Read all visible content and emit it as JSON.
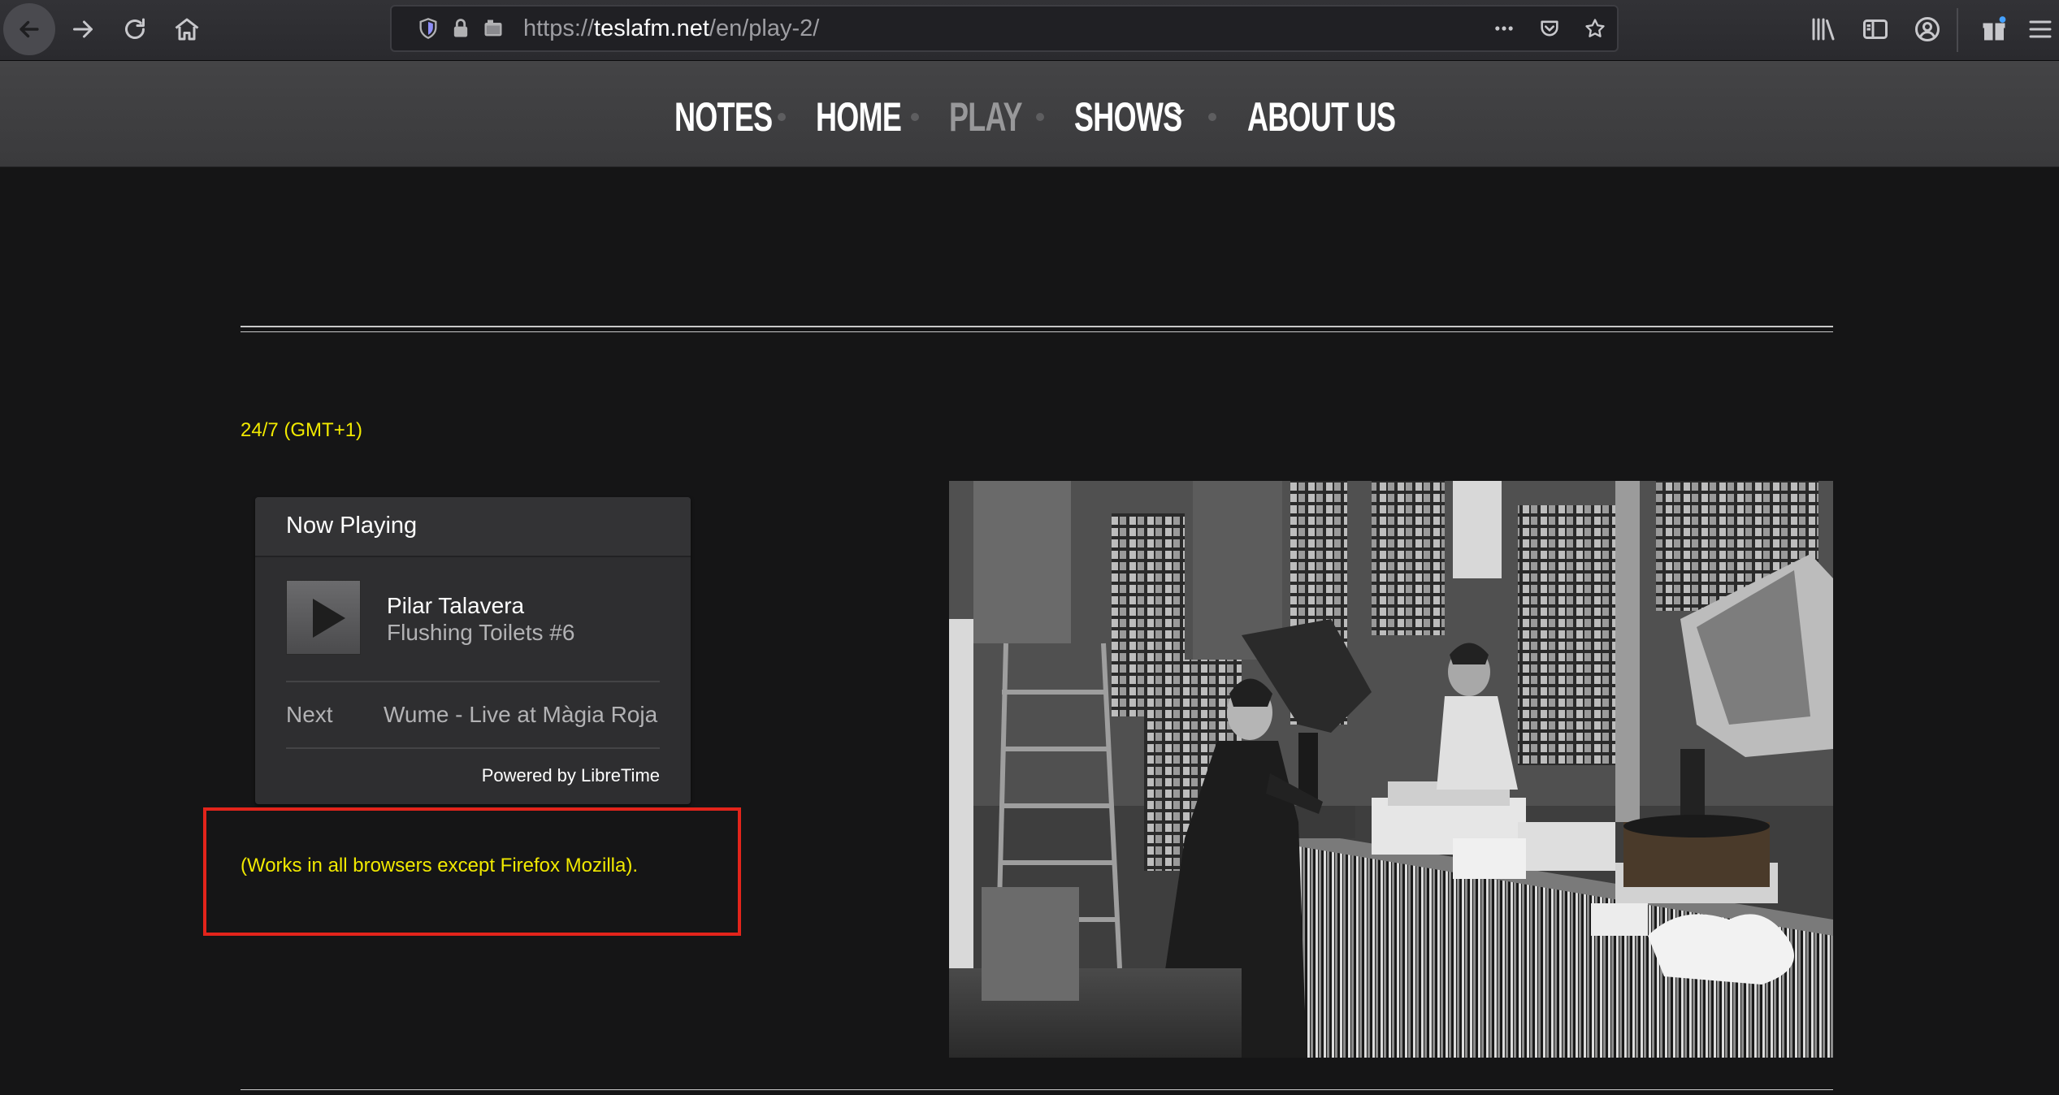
{
  "browser": {
    "url_prefix": "https://",
    "url_domain": "teslafm.net",
    "url_path": "/en/play-2/",
    "icons": {
      "back": "back-arrow-icon",
      "forward": "forward-arrow-icon",
      "reload": "reload-icon",
      "home": "home-icon",
      "tracking": "shield-icon",
      "lock": "lock-icon",
      "permissions": "permissions-icon",
      "page_actions": "more-icon",
      "pocket": "pocket-icon",
      "bookmark": "star-icon",
      "library": "library-icon",
      "sidebar": "sidebar-icon",
      "account": "account-icon",
      "whats_new": "gift-icon",
      "menu": "hamburger-menu-icon"
    }
  },
  "nav": {
    "items": [
      {
        "label": "NOTES",
        "active": false
      },
      {
        "label": "HOME",
        "active": false
      },
      {
        "label": "PLAY",
        "active": true
      },
      {
        "label": "SHOWS",
        "active": false,
        "has_dropdown": true
      },
      {
        "label": "ABOUT US",
        "active": false
      }
    ]
  },
  "content": {
    "schedule_text": "24/7 (GMT+1)",
    "player": {
      "title": "Now Playing",
      "artist": "Pilar Talavera",
      "track": "Flushing Toilets #6",
      "next_label": "Next",
      "next_track": "Wume - Live at Màgia Roja",
      "powered_by": "Powered by LibreTime"
    },
    "browser_note": "(Works in all browsers except Firefox Mozilla).",
    "photo_subject": "archival photo of women working among record shelves and gramophones"
  },
  "colors": {
    "page_background": "#151516",
    "nav_background": "#3f3f41",
    "accent_yellow": "#f1e900",
    "highlight_red": "#e3241b",
    "nav_active": "#98989a"
  }
}
